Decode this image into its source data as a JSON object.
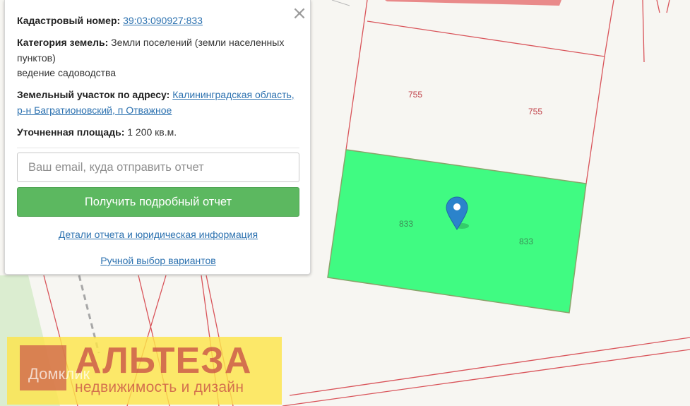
{
  "parcel": {
    "cadastral_label": "Кадастровый номер:",
    "cadastral_value": "39:03:090927:833",
    "category_label": "Категория земель:",
    "category_value": "Земли поселений (земли населенных пунктов)",
    "usage": "ведение садоводства",
    "address_label": "Земельный участок по адресу:",
    "address_value": "Калининградская область, р-н Багратионовский, п Отважное",
    "area_label": "Уточненная площадь:",
    "area_value": "1 200 кв.м."
  },
  "form": {
    "email_placeholder": "Ваш email, куда отправить отчет",
    "submit_label": "Получить подробный отчет",
    "details_link": "Детали отчета и юридическая информация",
    "manual_link": "Ручной выбор вариантов"
  },
  "close_icon": "close-icon",
  "map": {
    "labels": {
      "a": "755",
      "b": "755",
      "c": "833",
      "d": "833"
    },
    "marker_icon": "map-pin-icon",
    "colors": {
      "selected_fill": "#40fb82",
      "boundary": "#d9545a",
      "marker": "#2b83cb"
    }
  },
  "watermark": {
    "title": "АЛЬТЕЗА",
    "subtitle": "недвижимость и дизайн",
    "ghost": "Домклик"
  }
}
